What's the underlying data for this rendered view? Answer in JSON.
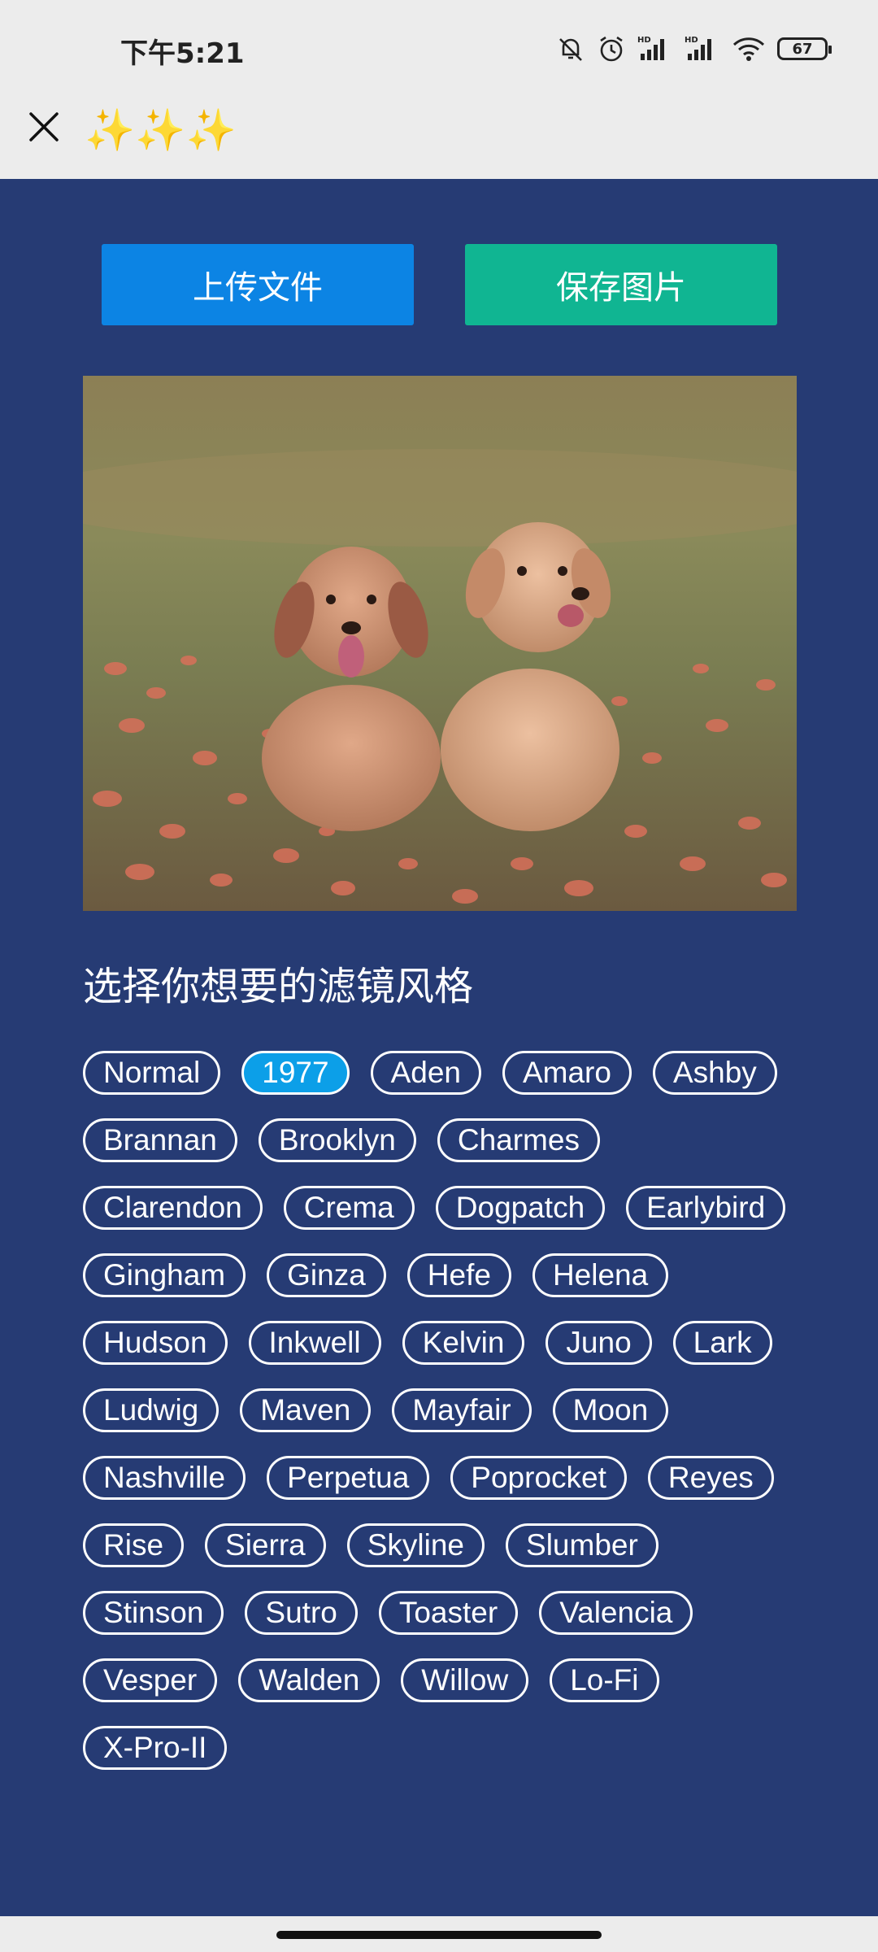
{
  "status_bar": {
    "time": "下午5:21",
    "battery": "67",
    "icons": [
      "mute-bell-icon",
      "alarm-icon",
      "hd-signal-icon",
      "hd-signal-icon",
      "wifi-icon",
      "battery-icon"
    ]
  },
  "title_bar": {
    "close_icon": "close-icon",
    "title": "✨✨✨"
  },
  "actions": {
    "upload_label": "上传文件",
    "save_label": "保存图片"
  },
  "colors": {
    "background": "#263b74",
    "upload": "#0c84e4",
    "save": "#10b592",
    "selected_filter": "#0c9fe8"
  },
  "heading": "选择你想要的滤镜风格",
  "filters": [
    "Normal",
    "1977",
    "Aden",
    "Amaro",
    "Ashby",
    "Brannan",
    "Brooklyn",
    "Charmes",
    "Clarendon",
    "Crema",
    "Dogpatch",
    "Earlybird",
    "Gingham",
    "Ginza",
    "Hefe",
    "Helena",
    "Hudson",
    "Inkwell",
    "Kelvin",
    "Juno",
    "Lark",
    "Ludwig",
    "Maven",
    "Mayfair",
    "Moon",
    "Nashville",
    "Perpetua",
    "Poprocket",
    "Reyes",
    "Rise",
    "Sierra",
    "Skyline",
    "Slumber",
    "Stinson",
    "Sutro",
    "Toaster",
    "Valencia",
    "Vesper",
    "Walden",
    "Willow",
    "Lo-Fi",
    "X-Pro-II"
  ],
  "selected_filter": "1977"
}
